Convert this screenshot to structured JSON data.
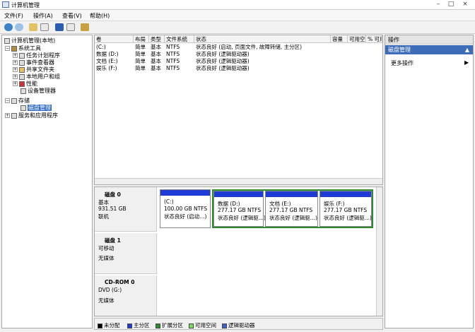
{
  "window": {
    "title": "计算机管理",
    "minimize_glyph": "–",
    "maximize_glyph": "□",
    "close_glyph": "×"
  },
  "menu": [
    "文件(F)",
    "操作(A)",
    "查看(V)",
    "帮助(H)"
  ],
  "toolbar": {
    "icons": [
      "back-icon",
      "forward-icon",
      "up-folder-icon",
      "show-hide-tree-icon",
      "help-icon",
      "properties-icon",
      "settings-icon"
    ]
  },
  "tree": {
    "root": "计算机管理(本地)",
    "system_tools": "系统工具",
    "task_scheduler": "任务计划程序",
    "event_viewer": "事件查看器",
    "shared_folders": "共享文件夹",
    "local_users": "本地用户和组",
    "performance": "性能",
    "device_manager": "设备管理器",
    "storage": "存储",
    "disk_management": "磁盘管理",
    "services_apps": "服务和应用程序",
    "expanded_glyph": "−",
    "collapsed_glyph": "+"
  },
  "volume_list": {
    "columns": [
      "卷",
      "布局",
      "类型",
      "文件系统",
      "状态",
      "容量",
      "可用空间",
      "% 可用"
    ],
    "rows": [
      {
        "vol": "(C:)",
        "layout": "简单",
        "type": "基本",
        "fs": "NTFS",
        "status": "状态良好 (启动, 页面文件, 故障转储, 主分区)"
      },
      {
        "vol": "数据 (D:)",
        "layout": "简单",
        "type": "基本",
        "fs": "NTFS",
        "status": "状态良好 (逻辑驱动器)"
      },
      {
        "vol": "文档 (E:)",
        "layout": "简单",
        "type": "基本",
        "fs": "NTFS",
        "status": "状态良好 (逻辑驱动器)"
      },
      {
        "vol": "娱乐 (F:)",
        "layout": "简单",
        "type": "基本",
        "fs": "NTFS",
        "status": "状态良好 (逻辑驱动器)"
      }
    ]
  },
  "disks": [
    {
      "name": "磁盘 0",
      "type": "基本",
      "size": "931.51 GB",
      "state": "联机",
      "partitions": [
        {
          "label": "(C:)",
          "size": "100.00 GB NTFS",
          "status": "状态良好 (启动...)"
        },
        {
          "label": "数据 (D:)",
          "size": "277.17 GB NTFS",
          "status": "状态良好 (逻辑驱...)"
        },
        {
          "label": "文档 (E:)",
          "size": "277.17 GB NTFS",
          "status": "状态良好 (逻辑驱...)"
        },
        {
          "label": "娱乐 (F:)",
          "size": "277.17 GB NTFS",
          "status": "状态良好 (逻辑驱...)"
        }
      ]
    },
    {
      "name": "磁盘 1",
      "type": "可移动",
      "size": "",
      "state": "无媒体"
    },
    {
      "name": "CD-ROM 0",
      "type": "DVD (G:)",
      "size": "",
      "state": "无媒体"
    }
  ],
  "legend": [
    {
      "label": "未分配",
      "color": "#000000"
    },
    {
      "label": "主分区",
      "color": "#1e3bd6"
    },
    {
      "label": "扩展分区",
      "color": "#2e8b2e"
    },
    {
      "label": "可用空间",
      "color": "#7fdc5a"
    },
    {
      "label": "逻辑驱动器",
      "color": "#3d5fd0"
    }
  ],
  "actions": {
    "header": "操作",
    "selected": "磁盘管理",
    "more": "更多操作",
    "up_caret": "▲",
    "right_caret": "▶"
  }
}
